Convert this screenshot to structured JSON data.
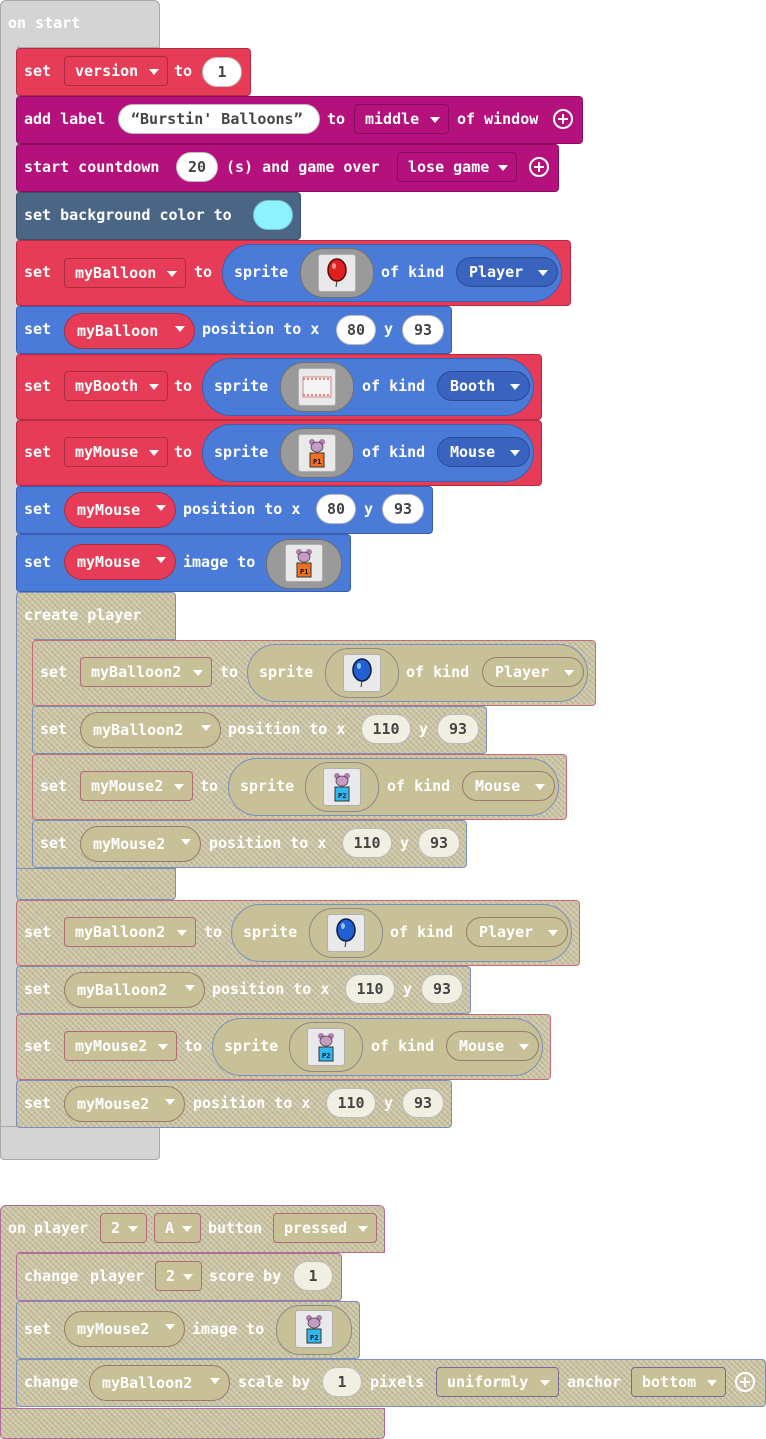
{
  "on_start": {
    "hat_label": "on start",
    "set_version": {
      "set": "set",
      "var": "version",
      "to": "to",
      "value": "1"
    },
    "add_label": {
      "add": "add label",
      "text": "Burstin' Balloons",
      "to": "to",
      "pos": "middle",
      "of_window": "of window"
    },
    "countdown": {
      "start": "start countdown",
      "value": "20",
      "rest": "(s) and game over",
      "choice": "lose game"
    },
    "background": {
      "label": "set background color to",
      "color": "#8ef1ff"
    },
    "my_balloon": {
      "set": "set",
      "var": "myBalloon",
      "to": "to",
      "sprite": "sprite",
      "of_kind": "of kind",
      "kind": "Player"
    },
    "my_balloon_pos": {
      "set": "set",
      "var": "myBalloon",
      "pos": "position to x",
      "x": "80",
      "y_label": "y",
      "y": "93"
    },
    "my_booth": {
      "set": "set",
      "var": "myBooth",
      "to": "to",
      "sprite": "sprite",
      "of_kind": "of kind",
      "kind": "Booth"
    },
    "my_mouse": {
      "set": "set",
      "var": "myMouse",
      "to": "to",
      "sprite": "sprite",
      "of_kind": "of kind",
      "kind": "Mouse"
    },
    "my_mouse_pos": {
      "set": "set",
      "var": "myMouse",
      "pos": "position to x",
      "x": "80",
      "y_label": "y",
      "y": "93"
    },
    "my_mouse_img": {
      "set": "set",
      "var": "myMouse",
      "img": "image to"
    },
    "create_player": {
      "label": "create player",
      "b1": {
        "set": "set",
        "var": "myBalloon2",
        "to": "to",
        "sprite": "sprite",
        "of_kind": "of kind",
        "kind": "Player"
      },
      "b2": {
        "set": "set",
        "var": "myBalloon2",
        "pos": "position to x",
        "x": "110",
        "y_label": "y",
        "y": "93"
      },
      "b3": {
        "set": "set",
        "var": "myMouse2",
        "to": "to",
        "sprite": "sprite",
        "of_kind": "of kind",
        "kind": "Mouse"
      },
      "b4": {
        "set": "set",
        "var": "myMouse2",
        "pos": "position to x",
        "x": "110",
        "y_label": "y",
        "y": "93"
      }
    },
    "o1": {
      "set": "set",
      "var": "myBalloon2",
      "to": "to",
      "sprite": "sprite",
      "of_kind": "of kind",
      "kind": "Player"
    },
    "o2": {
      "set": "set",
      "var": "myBalloon2",
      "pos": "position to x",
      "x": "110",
      "y_label": "y",
      "y": "93"
    },
    "o3": {
      "set": "set",
      "var": "myMouse2",
      "to": "to",
      "sprite": "sprite",
      "of_kind": "of kind",
      "kind": "Mouse"
    },
    "o4": {
      "set": "set",
      "var": "myMouse2",
      "pos": "position to x",
      "x": "110",
      "y_label": "y",
      "y": "93"
    }
  },
  "on_button": {
    "on": "on",
    "player": "player",
    "player_num": "2",
    "button_key": "A",
    "button": "button",
    "event": "pressed",
    "change_score": {
      "change": "change",
      "player": "player",
      "num": "2",
      "score_by": "score by",
      "value": "1"
    },
    "set_img": {
      "set": "set",
      "var": "myMouse2",
      "img": "image to"
    },
    "change_scale": {
      "change": "change",
      "var": "myBalloon2",
      "scale_by": "scale by",
      "value": "1",
      "pixels": "pixels",
      "mode": "uniformly",
      "anchor": "anchor",
      "anchor_val": "bottom"
    }
  },
  "colors": {
    "set_red": "#e63c58",
    "game_magenta": "#b5117d",
    "scene_slate": "#4b6584",
    "sprite_blue": "#4a7bd8",
    "disabled": "#c8c096"
  },
  "icons": [
    "red-balloon-sprite-icon",
    "booth-sprite-icon",
    "mouse-p1-sprite-icon",
    "blue-balloon-sprite-icon",
    "mouse-p2-sprite-icon",
    "add-argument-icon"
  ]
}
